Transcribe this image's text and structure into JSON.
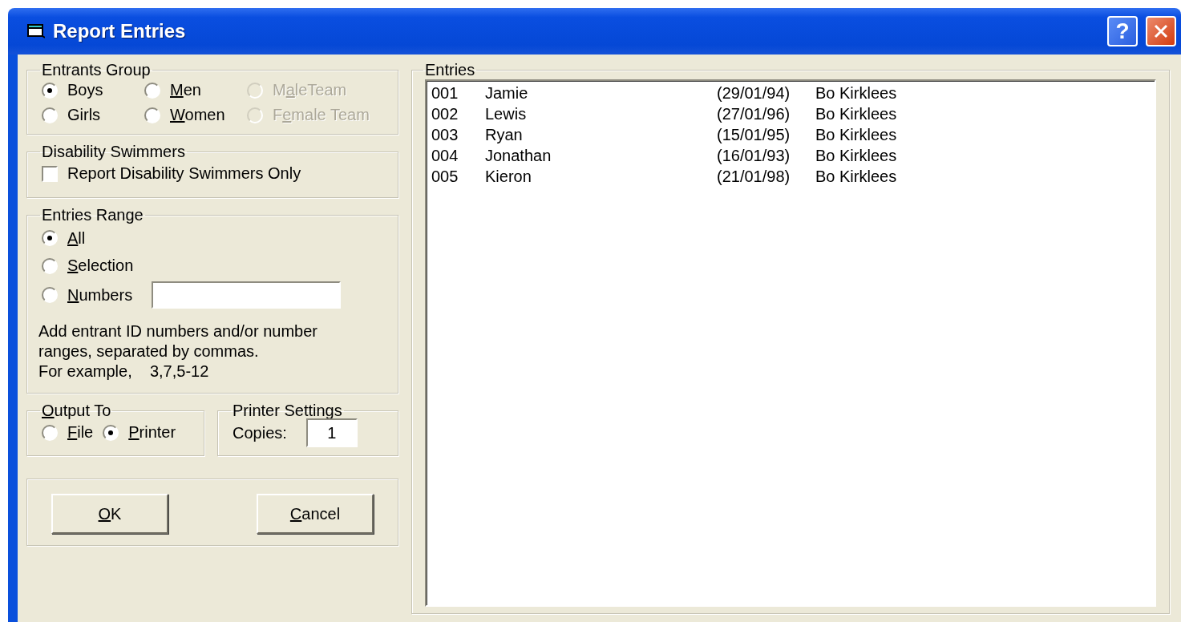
{
  "window": {
    "title": "Report Entries",
    "help": "?"
  },
  "entrants_group": {
    "legend": "Entrants Group",
    "options": [
      {
        "pre": "Boys",
        "selected": true,
        "disabled": false
      },
      {
        "key": "M",
        "post": "en",
        "selected": false,
        "disabled": false
      },
      {
        "pre": "M",
        "key": "a",
        "post": "leTeam",
        "selected": false,
        "disabled": true
      },
      {
        "pre": "Girls",
        "selected": false,
        "disabled": false
      },
      {
        "key": "W",
        "post": "omen",
        "selected": false,
        "disabled": false
      },
      {
        "pre": "F",
        "key": "e",
        "post": "male Team",
        "selected": false,
        "disabled": true
      }
    ]
  },
  "disability": {
    "legend": "Disability Swimmers",
    "checkbox": {
      "label": "Report Disability Swimmers Only",
      "checked": false
    }
  },
  "entries_range": {
    "legend": "Entries Range",
    "options": [
      {
        "kind": "plain",
        "key": "A",
        "post": "ll",
        "selected": true
      },
      {
        "kind": "plain",
        "key": "S",
        "post": "election",
        "selected": false
      },
      {
        "kind": "field",
        "key": "N",
        "post": "umbers",
        "selected": false
      }
    ],
    "note": [
      "Add entrant ID numbers and/or number",
      "ranges, separated by commas.",
      "For example,    3,7,5-12"
    ]
  },
  "output_to": {
    "legend": {
      "key": "O",
      "post": "utput To"
    },
    "options": [
      {
        "key": "F",
        "post": "ile",
        "selected": false
      },
      {
        "key": "P",
        "post": "rinter",
        "selected": true
      }
    ]
  },
  "printer_settings": {
    "legend": "Printer Settings",
    "copies_label": "Copies:",
    "copies_value": "1"
  },
  "buttons": [
    {
      "key": "O",
      "post": "K"
    },
    {
      "key": "C",
      "post": "ancel"
    }
  ],
  "entries": {
    "legend": "Entries",
    "rows": [
      {
        "number": "001",
        "name": "Jamie",
        "dob": "(29/01/94)",
        "club": "Bo Kirklees"
      },
      {
        "number": "002",
        "name": "Lewis",
        "dob": "(27/01/96)",
        "club": "Bo Kirklees"
      },
      {
        "number": "003",
        "name": "Ryan",
        "dob": "(15/01/95)",
        "club": "Bo Kirklees"
      },
      {
        "number": "004",
        "name": "Jonathan",
        "dob": "(16/01/93)",
        "club": "Bo Kirklees"
      },
      {
        "number": "005",
        "name": "Kieron",
        "dob": "(21/01/98)",
        "club": "Bo Kirklees"
      }
    ]
  }
}
